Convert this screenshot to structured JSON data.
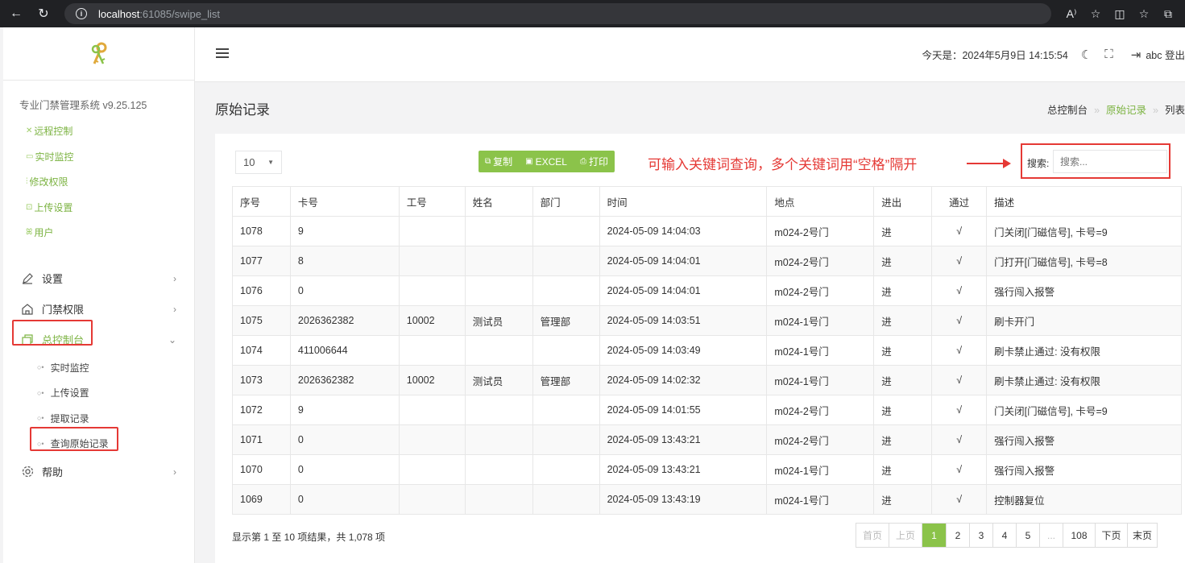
{
  "browser": {
    "url_host": "localhost",
    "url_rest": ":61085/swipe_list"
  },
  "sidebar": {
    "system_title": "专业门禁管理系统 v9.25.125",
    "quick_links": [
      {
        "label": "远程控制"
      },
      {
        "label": "实时监控"
      },
      {
        "label": "修改权限"
      },
      {
        "label": "上传设置"
      },
      {
        "label": "用户"
      }
    ],
    "menu": {
      "settings": "设置",
      "access": "门禁权限",
      "console": "总控制台",
      "help": "帮助"
    },
    "submenu": [
      {
        "label": "实时监控"
      },
      {
        "label": "上传设置"
      },
      {
        "label": "提取记录"
      },
      {
        "label": "查询原始记录"
      }
    ]
  },
  "header": {
    "datetime": "今天是：2024年5月9日 14:15:54",
    "user": "abc 登出"
  },
  "page": {
    "title": "原始记录",
    "breadcrumb": [
      "总控制台",
      "原始记录",
      "列表"
    ]
  },
  "toolbar": {
    "page_length": "10",
    "copy": "复制",
    "excel": "EXCEL",
    "print": "打印",
    "annotation": "可输入关键词查询，多个关键词用“空格”隔开",
    "search_label": "搜索:",
    "search_placeholder": "搜索..."
  },
  "table": {
    "headers": [
      "序号",
      "卡号",
      "工号",
      "姓名",
      "部门",
      "时间",
      "地点",
      "进出",
      "通过",
      "描述"
    ],
    "rows": [
      [
        "1078",
        "9",
        "",
        "",
        "",
        "2024-05-09 14:04:03",
        "m024-2号门",
        "进",
        "√",
        "门关闭[门磁信号], 卡号=9"
      ],
      [
        "1077",
        "8",
        "",
        "",
        "",
        "2024-05-09 14:04:01",
        "m024-2号门",
        "进",
        "√",
        "门打开[门磁信号], 卡号=8"
      ],
      [
        "1076",
        "0",
        "",
        "",
        "",
        "2024-05-09 14:04:01",
        "m024-2号门",
        "进",
        "√",
        "强行闯入报警"
      ],
      [
        "1075",
        "2026362382",
        "10002",
        "测试员",
        "管理部",
        "2024-05-09 14:03:51",
        "m024-1号门",
        "进",
        "√",
        "刷卡开门"
      ],
      [
        "1074",
        "411006644",
        "",
        "",
        "",
        "2024-05-09 14:03:49",
        "m024-1号门",
        "进",
        "√",
        "刷卡禁止通过: 没有权限"
      ],
      [
        "1073",
        "2026362382",
        "10002",
        "测试员",
        "管理部",
        "2024-05-09 14:02:32",
        "m024-1号门",
        "进",
        "√",
        "刷卡禁止通过: 没有权限"
      ],
      [
        "1072",
        "9",
        "",
        "",
        "",
        "2024-05-09 14:01:55",
        "m024-2号门",
        "进",
        "√",
        "门关闭[门磁信号], 卡号=9"
      ],
      [
        "1071",
        "0",
        "",
        "",
        "",
        "2024-05-09 13:43:21",
        "m024-2号门",
        "进",
        "√",
        "强行闯入报警"
      ],
      [
        "1070",
        "0",
        "",
        "",
        "",
        "2024-05-09 13:43:21",
        "m024-1号门",
        "进",
        "√",
        "强行闯入报警"
      ],
      [
        "1069",
        "0",
        "",
        "",
        "",
        "2024-05-09 13:43:19",
        "m024-1号门",
        "进",
        "√",
        "控制器复位"
      ]
    ]
  },
  "footer": {
    "info": "显示第 1 至 10 项结果，共 1,078 项",
    "pages": [
      "首页",
      "上页",
      "1",
      "2",
      "3",
      "4",
      "5",
      "...",
      "108",
      "下页",
      "末页"
    ],
    "active_page": "1",
    "disabled_pages": [
      "首页",
      "上页"
    ]
  },
  "colors": {
    "accent": "#8bc34a",
    "annotation_red": "#e53935"
  }
}
